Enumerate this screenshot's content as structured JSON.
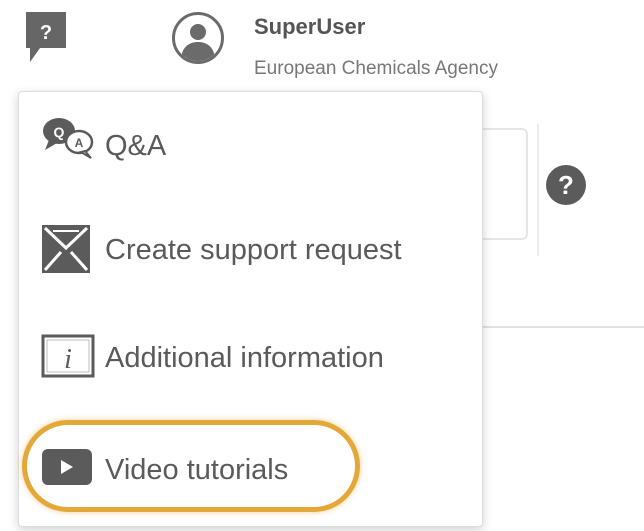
{
  "user": {
    "name": "SuperUser",
    "organisation": "European Chemicals Agency"
  },
  "help_toggle_icon": "question-mark-speech-icon",
  "menu": {
    "items": [
      {
        "label": "Q&A",
        "icon": "chat-bubbles-icon"
      },
      {
        "label": "Create support request",
        "icon": "envelope-icon"
      },
      {
        "label": "Additional information",
        "icon": "info-icon"
      },
      {
        "label": "Video tutorials",
        "icon": "video-play-icon"
      }
    ],
    "highlighted_item": "Video tutorials"
  },
  "background": {
    "help_icon_glyph": "?"
  },
  "colors": {
    "icon_gray": "#5b5b5b",
    "text_gray": "#5a5a5a",
    "highlight_orange": "#e3a837"
  }
}
